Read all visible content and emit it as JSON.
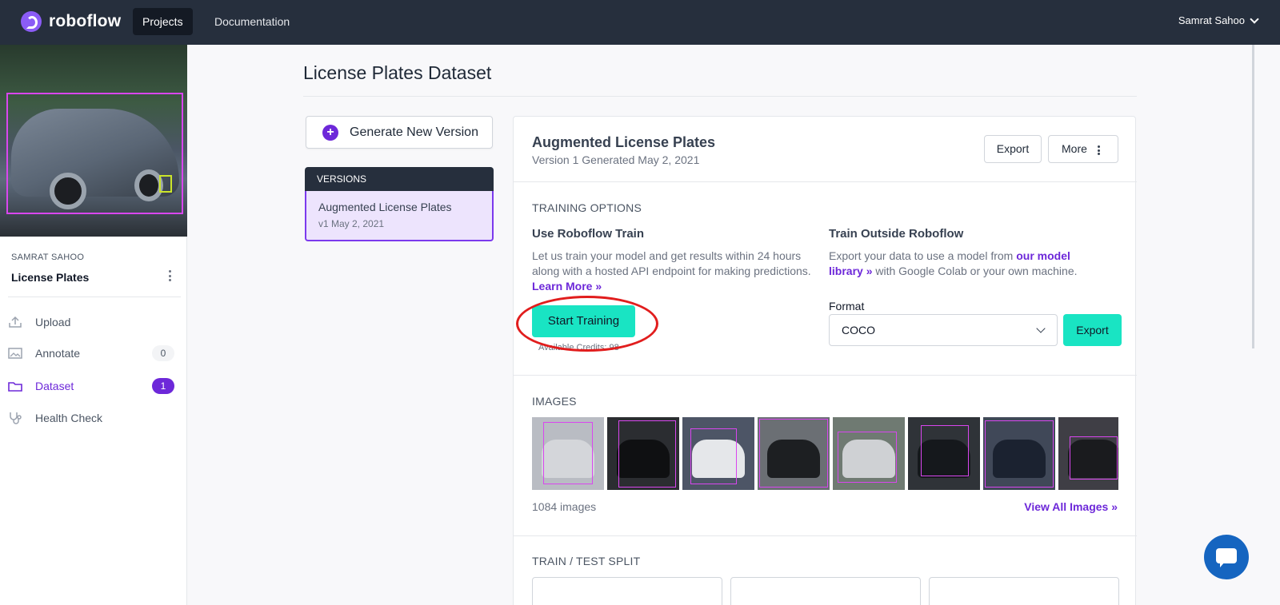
{
  "topbar": {
    "brand": "roboflow",
    "nav": [
      "Projects",
      "Documentation"
    ],
    "user": "Samrat Sahoo"
  },
  "sidebar": {
    "workspace": "SAMRAT SAHOO",
    "project": "License Plates",
    "items": [
      {
        "label": "Upload",
        "icon": "upload-icon"
      },
      {
        "label": "Annotate",
        "icon": "annotate-icon",
        "badge": "0"
      },
      {
        "label": "Dataset",
        "icon": "dataset-icon",
        "badge": "1"
      },
      {
        "label": "Health Check",
        "icon": "stethoscope-icon"
      }
    ]
  },
  "main": {
    "title": "License Plates Dataset",
    "generate_label": "Generate New Version",
    "versions_header": "VERSIONS",
    "version": {
      "name": "Augmented License Plates",
      "sub": "v1 May 2, 2021"
    }
  },
  "card": {
    "title": "Augmented License Plates",
    "subtitle": "Version 1 Generated May 2, 2021",
    "export_label": "Export",
    "more_label": "More",
    "training_options": "TRAINING OPTIONS",
    "train": {
      "title": "Use Roboflow Train",
      "text": "Let us train your model and get results within 24 hours along with a hosted API endpoint for making predictions.",
      "link": "Learn More »",
      "button": "Start Training",
      "credits": "Available Credits: 98"
    },
    "outside": {
      "title": "Train Outside Roboflow",
      "text_before": "Export your data to use a model from",
      "link": "our model library »",
      "text_after": "with Google Colab or your own machine.",
      "format_label": "Format",
      "format_value": "COCO",
      "export_label": "Export"
    },
    "images_label": "IMAGES",
    "image_count": "1084 images",
    "view_all": "View All Images »",
    "split_label": "TRAIN / TEST SPLIT"
  },
  "colors": {
    "accent": "#6d28d9",
    "teal": "#19e4c3",
    "navbar": "#262f3d",
    "annotation": "#e11d1d"
  }
}
